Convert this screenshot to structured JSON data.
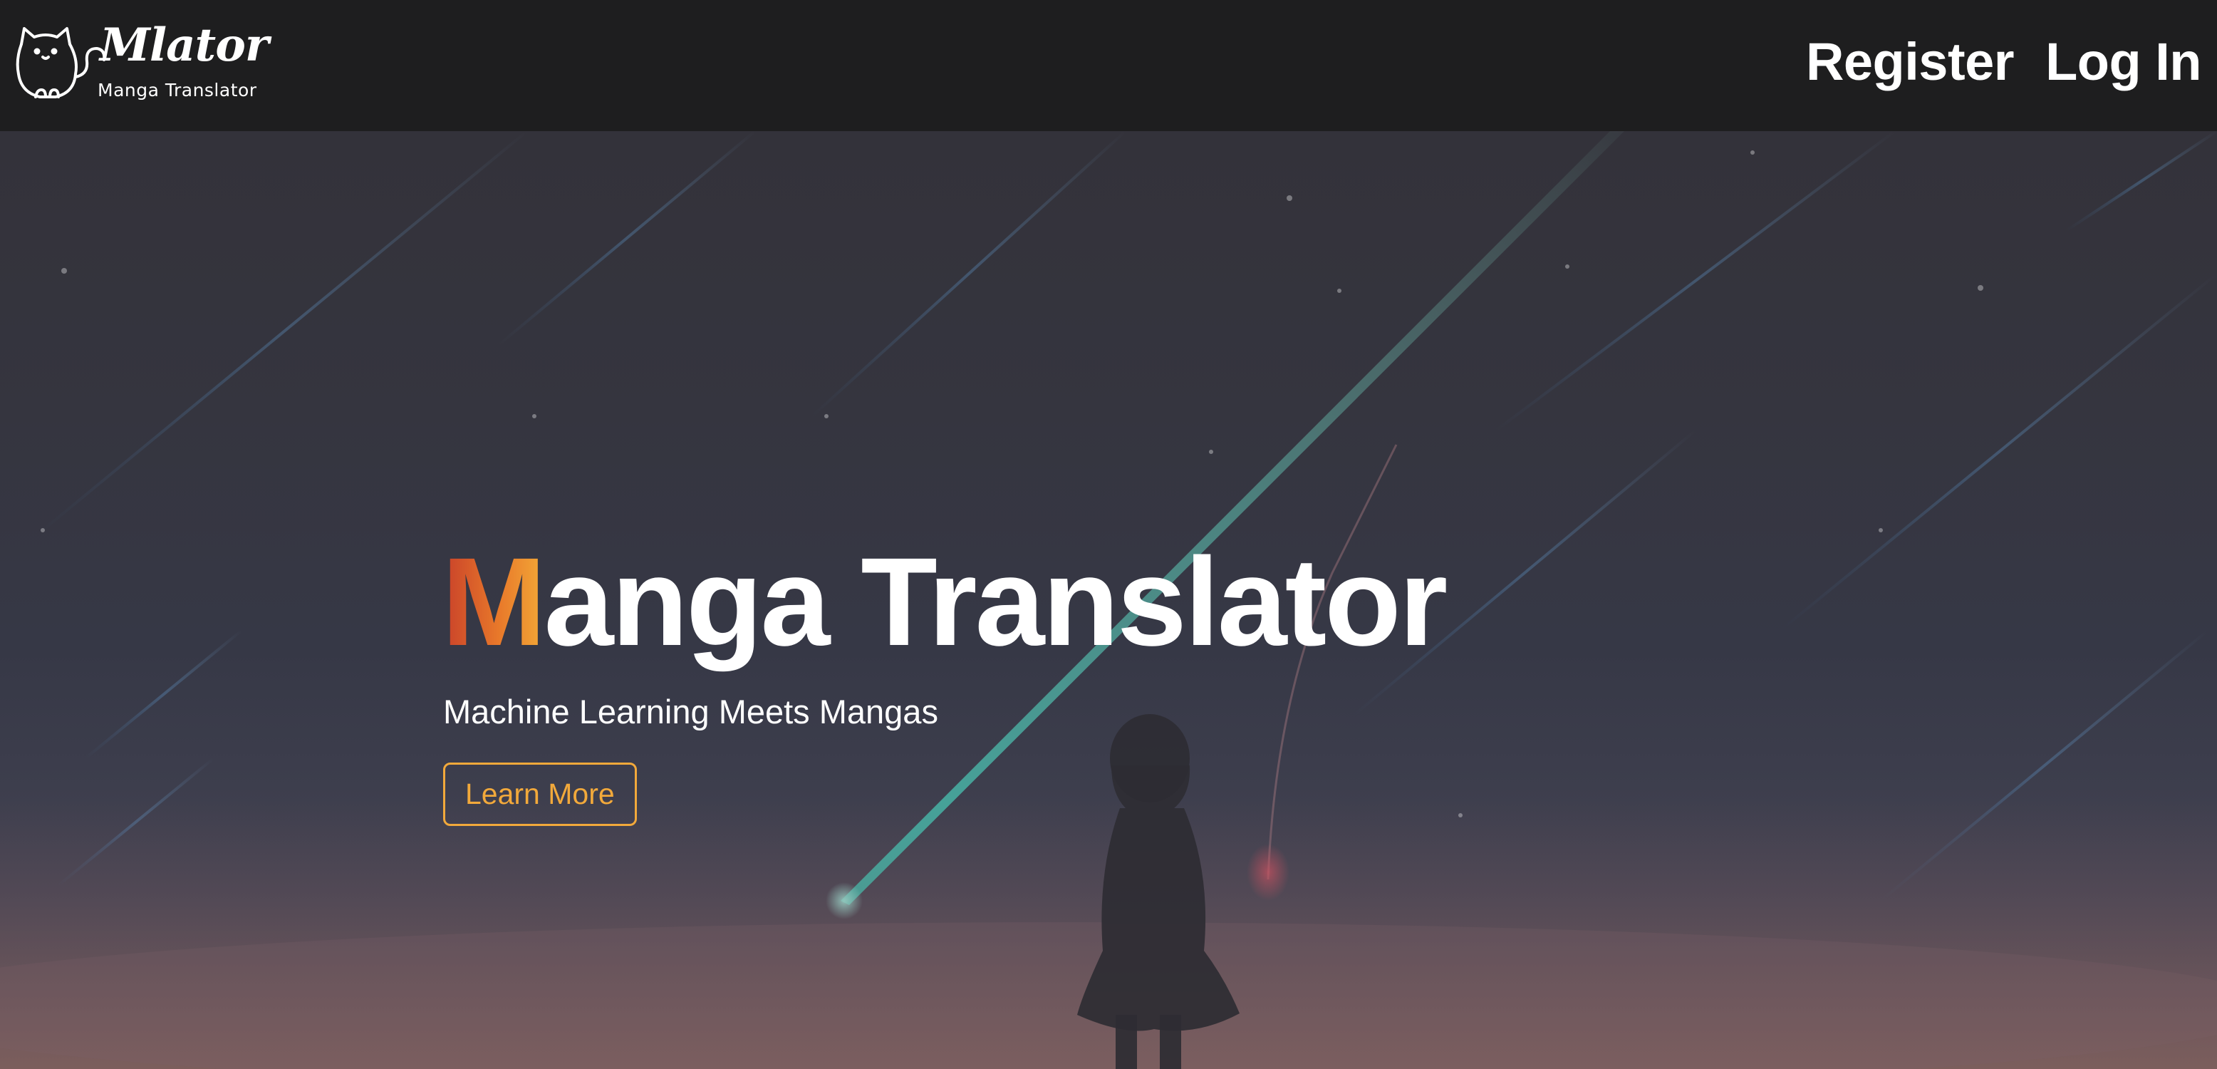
{
  "navbar": {
    "brand": {
      "wordmark": "Mlator",
      "tagline": "Manga Translator",
      "logo_icon": "cat-icon"
    },
    "links": [
      {
        "label": "Register"
      },
      {
        "label": "Log In"
      }
    ]
  },
  "hero": {
    "title_first_letter": "M",
    "title_rest": "anga Translator",
    "subtitle": "Machine Learning Meets Mangas",
    "cta_label": "Learn More",
    "background_scene": "night-sky-meteor-girl-silhouette"
  },
  "colors": {
    "navbar_bg": "#1e1e1f",
    "accent_orange": "#f2a93b",
    "accent_red": "#c8402a",
    "text": "#ffffff"
  }
}
